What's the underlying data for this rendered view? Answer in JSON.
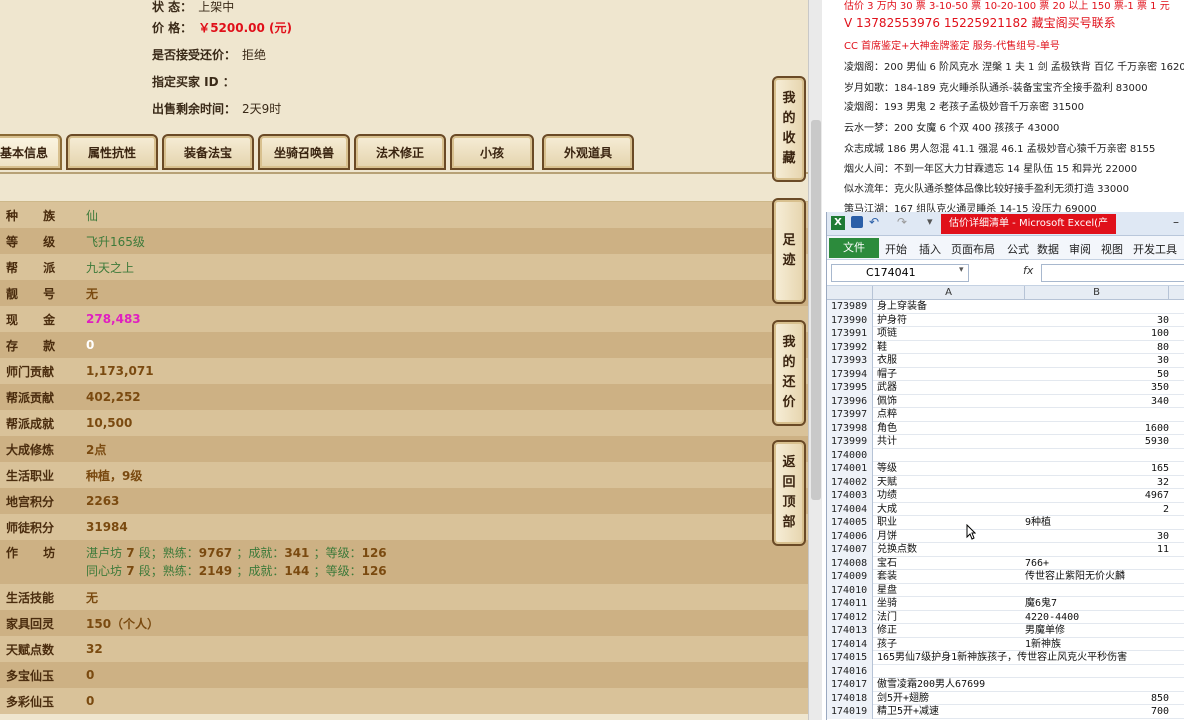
{
  "trade": {
    "status_label": "状        态：",
    "status_value": "上架中",
    "price_label": "价        格：",
    "price_value": "￥5200.00 (元)",
    "bargain_label": "是否接受还价：",
    "bargain_value": "拒绝",
    "buyer_label": "指定买家 ID ：",
    "buyer_value": "",
    "remain_label": "出售剩余时间：",
    "remain_value": "2天9时"
  },
  "tabs": [
    "基本信息",
    "属性抗性",
    "装备法宝",
    "坐骑召唤兽",
    "法术修正",
    "小孩",
    "外观道具"
  ],
  "attributes": [
    {
      "label": "种      族",
      "value": "仙",
      "style": "green"
    },
    {
      "label": "等      级",
      "value": "飞升165级",
      "style": "green"
    },
    {
      "label": "帮      派",
      "value": "九天之上",
      "style": "green"
    },
    {
      "label": "靓      号",
      "value": "无",
      "style": "brown"
    },
    {
      "label": "现      金",
      "value": "278,483",
      "style": "pink"
    },
    {
      "label": "存      款",
      "value": "0",
      "style": "white"
    },
    {
      "label": "师门贡献",
      "value": "1,173,071",
      "style": "brown"
    },
    {
      "label": "帮派贡献",
      "value": "402,252",
      "style": "brown"
    },
    {
      "label": "帮派成就",
      "value": "10,500",
      "style": "brown"
    },
    {
      "label": "大成修炼",
      "value": "2点",
      "style": "brown"
    },
    {
      "label": "生活职业",
      "value": "种植，9级",
      "style": "brown"
    },
    {
      "label": "地宫积分",
      "value": "2263",
      "style": "brown"
    },
    {
      "label": "师徒积分",
      "value": "31984",
      "style": "brown"
    }
  ],
  "workshop": {
    "label": "作      坊",
    "line1_a": "湛卢坊",
    "line1_b": "7",
    "line1_c": "段；熟练：",
    "line1_d": "9767",
    "line1_e": "；成就：",
    "line1_f": "341",
    "line1_g": "；等级：",
    "line1_h": "126",
    "line2_a": "同心坊",
    "line2_b": "7",
    "line2_c": "段；熟练：",
    "line2_d": "2149",
    "line2_e": "；成就：",
    "line2_f": "144",
    "line2_g": "；等级：",
    "line2_h": "126"
  },
  "attributes2": [
    {
      "label": "生活技能",
      "value": "无",
      "style": "brown"
    },
    {
      "label": "家具回灵",
      "value": "150（个人）",
      "style": "brown"
    },
    {
      "label": "天赋点数",
      "value": "32",
      "style": "brown"
    },
    {
      "label": "多宝仙玉",
      "value": "0",
      "style": "brown"
    },
    {
      "label": "多彩仙玉",
      "value": "0",
      "style": "brown"
    }
  ],
  "side_buttons": [
    {
      "label": "我的收藏",
      "chars": [
        "我",
        "的",
        "收",
        "藏"
      ]
    },
    {
      "label": "足迹",
      "chars": [
        "足",
        "迹"
      ]
    },
    {
      "label": "我的还价",
      "chars": [
        "我",
        "的",
        "还",
        "价"
      ]
    },
    {
      "label": "返回顶部",
      "chars": [
        "返",
        "回",
        "顶",
        "部"
      ]
    }
  ],
  "doc_lines": [
    {
      "text": "估价 3 万内 30 票  3-10-50 票  10-20-100 票  20 以上 150 票-1 票 1 元",
      "style": "red"
    },
    {
      "text": "V 13782553976    15225921182   藏宝阁买号联系",
      "style": "red-big"
    },
    {
      "text": "CC 首席鉴定+大神金牌鉴定   服务-代售组号-单号",
      "style": "red"
    },
    {
      "text": "凌烟阁：200 男仙 6 阶风克水 涅槃 1 夫 1 剑 孟极铁背 百亿 千万亲密 1620",
      "style": "normal"
    },
    {
      "text": "岁月如歌：184-189 克火睡杀队通杀-装备宝宝齐全接手盈利 83000",
      "style": "normal"
    },
    {
      "text": "凌烟阁：193 男鬼 2 老孩子孟极妙音千万亲密 31500",
      "style": "normal"
    },
    {
      "text": "云水一梦：200 女魔 6 个双 400 孩孩子 43000",
      "style": "normal"
    },
    {
      "text": "众志成城 186 男人忽混 41.1 强混 46.1 孟极妙音心猿千万亲密 8155",
      "style": "normal"
    },
    {
      "text": "烟火人间：不到一年区大力甘霖遗忘 14 星队伍 15 和异光 22000",
      "style": "normal"
    },
    {
      "text": "似水流年：克火队通杀整体品像比较好接手盈利无须打造 33000",
      "style": "normal"
    },
    {
      "text": "策马江湖：167 组队克火通灵睡杀 14-15 没压力 69000",
      "style": "normal"
    }
  ],
  "excel": {
    "title": "估价详细清单 - Microsoft Excel(产",
    "file_tab": "文件",
    "ribbon_tabs": [
      "开始",
      "插入",
      "页面布局",
      "公式",
      "数据",
      "审阅",
      "视图",
      "开发工具"
    ],
    "name_box": "C174041",
    "fx": "fx",
    "col_a": "A",
    "col_b": "B",
    "rows": [
      {
        "n": "173989",
        "a": "身上穿装备",
        "b": ""
      },
      {
        "n": "173990",
        "a": "护身符",
        "b": "30"
      },
      {
        "n": "173991",
        "a": "项链",
        "b": "100"
      },
      {
        "n": "173992",
        "a": "鞋",
        "b": "80"
      },
      {
        "n": "173993",
        "a": "衣服",
        "b": "30"
      },
      {
        "n": "173994",
        "a": "帽子",
        "b": "50"
      },
      {
        "n": "173995",
        "a": "武器",
        "b": "350"
      },
      {
        "n": "173996",
        "a": "佩饰",
        "b": "340"
      },
      {
        "n": "173997",
        "a": "点粹",
        "b": ""
      },
      {
        "n": "173998",
        "a": "角色",
        "b": "1600"
      },
      {
        "n": "173999",
        "a": "共计",
        "b": "5930"
      },
      {
        "n": "174000",
        "a": "",
        "b": ""
      },
      {
        "n": "174001",
        "a": "等级",
        "b": "165"
      },
      {
        "n": "174002",
        "a": "天赋",
        "b": "32"
      },
      {
        "n": "174003",
        "a": "功绩",
        "b": "4967"
      },
      {
        "n": "174004",
        "a": "大成",
        "b": "2"
      },
      {
        "n": "174005",
        "a": "职业",
        "b": "9种植",
        "bl": true
      },
      {
        "n": "174006",
        "a": "月饼",
        "b": "30"
      },
      {
        "n": "174007",
        "a": "兑换点数",
        "b": "11"
      },
      {
        "n": "174008",
        "a": "宝石",
        "b": "766+",
        "bl": true
      },
      {
        "n": "174009",
        "a": "套装",
        "b": "传世容止紫阳无价火麟",
        "bl": true
      },
      {
        "n": "174010",
        "a": "星盘",
        "b": ""
      },
      {
        "n": "174011",
        "a": "坐骑",
        "b": "魔6鬼7",
        "bl": true
      },
      {
        "n": "174012",
        "a": "法门",
        "b": "4220-4400",
        "bl": true
      },
      {
        "n": "174013",
        "a": "修正",
        "b": "男魔单修",
        "bl": true
      },
      {
        "n": "174014",
        "a": "孩子",
        "b": "1新神族",
        "bl": true
      },
      {
        "n": "174015",
        "a": "165男仙7级护身1新神族孩子，传世容止风克火平秒伤害",
        "b": ""
      },
      {
        "n": "174016",
        "a": "",
        "b": ""
      },
      {
        "n": "174017",
        "a": "傲雪凌霜200男人67699",
        "b": ""
      },
      {
        "n": "174018",
        "a": "剑5开+翅膀",
        "b": "850"
      },
      {
        "n": "174019",
        "a": "精卫5开+减速",
        "b": "700"
      }
    ]
  },
  "colors": {
    "price_red": "#e0101a",
    "cash_pink": "#e020c0",
    "excel_green": "#2c8b3c"
  }
}
